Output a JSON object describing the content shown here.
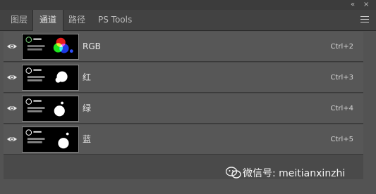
{
  "panel": {
    "top_controls": {
      "collapse": "«",
      "close": "×"
    },
    "tabs": [
      {
        "label": "图层",
        "active": false
      },
      {
        "label": "通道",
        "active": true
      },
      {
        "label": "路径",
        "active": false
      },
      {
        "label": "PS Tools",
        "active": false
      }
    ]
  },
  "channels": [
    {
      "name": "RGB",
      "shortcut": "Ctrl+2",
      "visible": true
    },
    {
      "name": "红",
      "shortcut": "Ctrl+3",
      "visible": true
    },
    {
      "name": "绿",
      "shortcut": "Ctrl+4",
      "visible": true
    },
    {
      "name": "蓝",
      "shortcut": "Ctrl+5",
      "visible": true
    }
  ],
  "watermark": {
    "text": "微信号: meitianxinzhi"
  },
  "colors": {
    "panel_bg": "#535353",
    "row_bg": "#575757",
    "tab_bar": "#424242"
  }
}
